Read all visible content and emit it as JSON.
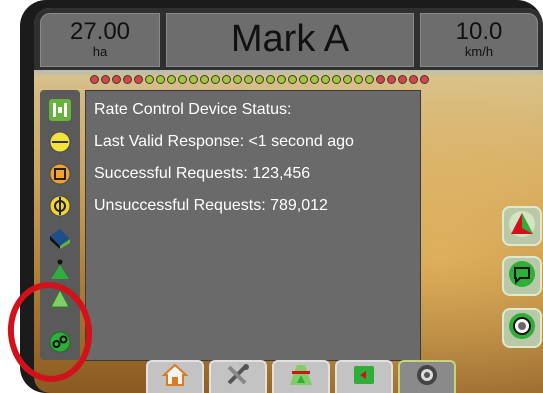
{
  "header": {
    "area": {
      "value": "27.00",
      "unit": "ha"
    },
    "title": "Mark A",
    "speed": {
      "value": "10.0",
      "unit": "km/h"
    }
  },
  "led_bar": {
    "count": 31,
    "colors": {
      "red": "#d7454b",
      "green": "#a4c73b"
    },
    "pattern": [
      "red",
      "red",
      "red",
      "red",
      "red",
      "green",
      "green",
      "green",
      "green",
      "green",
      "green",
      "green",
      "green",
      "green",
      "green",
      "green",
      "green",
      "green",
      "green",
      "green",
      "green",
      "green",
      "green",
      "green",
      "green",
      "green",
      "red",
      "red",
      "red",
      "red",
      "red"
    ]
  },
  "sidebar": {
    "items": [
      {
        "name": "section-control-icon"
      },
      {
        "name": "straight-guidance-icon"
      },
      {
        "name": "boundary-icon"
      },
      {
        "name": "steering-icon"
      },
      {
        "name": "swath-width-icon"
      },
      {
        "name": "auto-section-icon"
      },
      {
        "name": "guidance-mode-icon"
      },
      {
        "name": "rate-control-icon"
      }
    ]
  },
  "dialog": {
    "title": "Rate Control Device Status:",
    "lines": [
      "Last Valid Response: <1 second ago",
      "Successful Requests: 123,456",
      "Unsuccessful Requests: 789,012"
    ]
  },
  "right_buttons": [
    {
      "name": "guidance-arrow-icon"
    },
    {
      "name": "message-icon"
    },
    {
      "name": "camera-icon"
    }
  ],
  "bottom_bar": {
    "items": [
      {
        "name": "home-icon"
      },
      {
        "name": "tools-icon"
      },
      {
        "name": "vehicle-view-icon"
      },
      {
        "name": "guidance-view-icon"
      },
      {
        "name": "camera-tab-icon"
      }
    ],
    "active_index": 4
  },
  "highlight_color": "#d1121a"
}
